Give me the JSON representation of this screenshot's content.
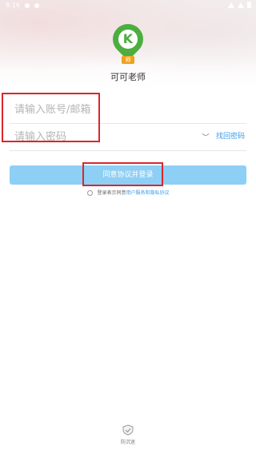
{
  "status": {
    "time": "8:16"
  },
  "app": {
    "title": "可可老师",
    "logo_tag": "师",
    "logo_letter": "K"
  },
  "form": {
    "account_placeholder": "请输入账号/邮箱",
    "password_placeholder": "请输入密码",
    "forgot_password": "找回密码",
    "login_button": "同意协议并登录"
  },
  "agreement": {
    "prefix": "登录表示同意",
    "link": "用户服务和隐私协议"
  },
  "footer": {
    "guard_label": "防沉迷"
  },
  "colors": {
    "brand_green": "#4cae3e",
    "button_blue": "#8ecff5",
    "link_blue": "#3b9be6",
    "highlight_red": "#d9262c"
  },
  "icons": [
    "eye-closed-icon",
    "shield-check-icon",
    "radio-icon"
  ]
}
